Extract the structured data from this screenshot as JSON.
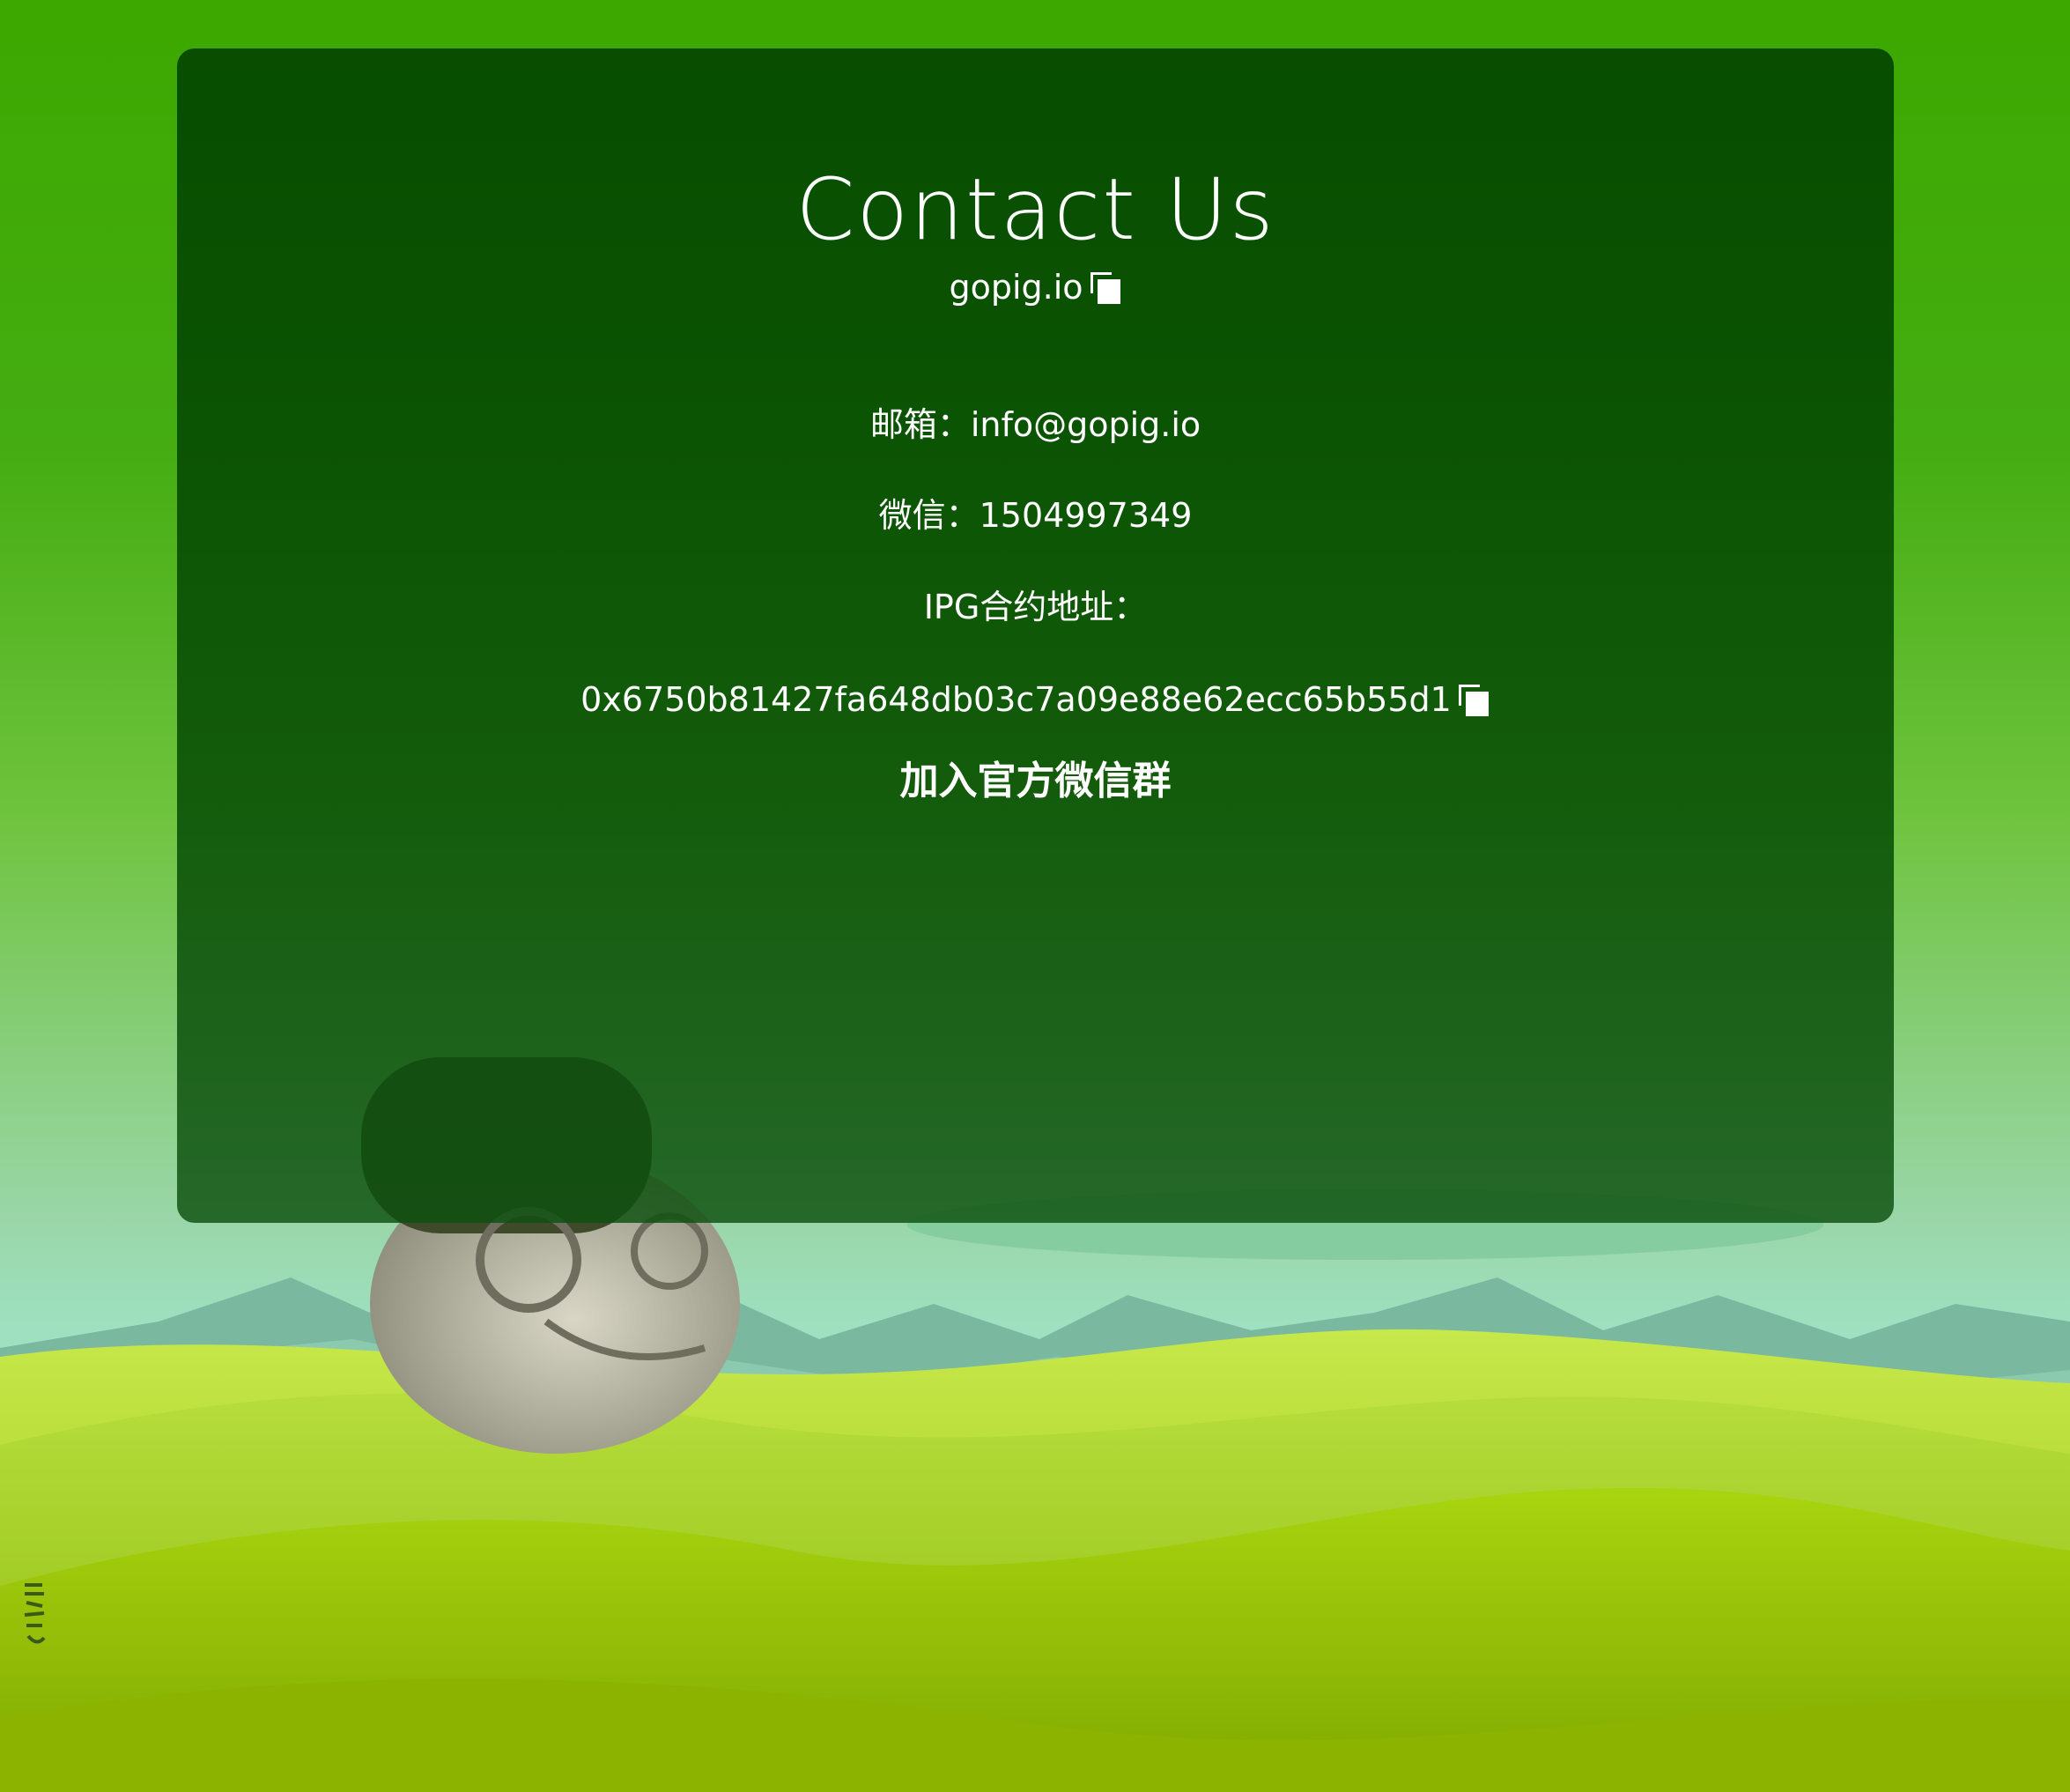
{
  "contact": {
    "title": "Contact Us",
    "site": "gopig.io",
    "email_label": "邮箱：",
    "email": "info@gopig.io",
    "wechat_label": "微信：",
    "wechat": "1504997349",
    "contract_label": "IPG合约地址：",
    "contract_address": "0x6750b81427fa648db03c7a09e88e62ecc65b55d1",
    "join_group": "加入官方微信群"
  },
  "icons": {
    "copy": "copy-icon"
  },
  "colors": {
    "sky": "#3da800",
    "panel": "#0a5200",
    "text": "#ffffff",
    "grass": "#a8d21a"
  }
}
